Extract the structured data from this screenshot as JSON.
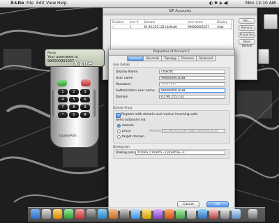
{
  "menubar": {
    "app_name": "X-Lite",
    "menus": [
      "File",
      "Edit",
      "View",
      "Help"
    ],
    "clock": "Mon 12:10 AM"
  },
  "desktop": {
    "icons": [
      {
        "name": "hard-drive-icon",
        "label": ""
      },
      {
        "name": "document-icon",
        "label": "..."
      }
    ]
  },
  "sip_accounts": {
    "title": "SIP Accounts",
    "columns": [
      "Enabled",
      "Acct #",
      "Domain",
      "User name",
      "Display"
    ],
    "rows": [
      {
        "enabled": "✓",
        "acct": "1",
        "domain": "61.90.255.132 (default)",
        "user": "990000001037",
        "display": "chak"
      }
    ],
    "buttons": [
      "Add...",
      "Remove",
      "Properties",
      "Make Default"
    ]
  },
  "phone": {
    "screen_title": "Ready",
    "screen_text": "Your username is: 990000001037",
    "logo": "X-Lite",
    "brand": "CounterPath",
    "keys": [
      "1",
      "2",
      "3",
      "4",
      "5",
      "6",
      "7",
      "8",
      "9",
      "*",
      "0",
      "#"
    ]
  },
  "props": {
    "title": "Properties of Account 1",
    "tabs": [
      "Account",
      "Voicemail",
      "Topology",
      "Presence",
      "Advanced"
    ],
    "user_details": {
      "group_title": "User Details",
      "display_name_label": "Display Name",
      "display_name": "chaktat",
      "user_name_label": "User name",
      "user_name": "990000001038",
      "password_label": "Password",
      "password": "••••••••",
      "auth_label": "Authorization user name",
      "auth_name": "990000001038",
      "domain_label": "Domain",
      "domain": "61.90.255.132"
    },
    "domain_proxy": {
      "group_title": "Domain Proxy",
      "register_label": "Register with domain and receive incoming calls",
      "send_via_label": "Send outbound via:",
      "options": [
        "domain",
        "proxy",
        "target domain"
      ],
      "address_label": "Address",
      "address_value": "61.90.226.194.static.asianet.co.th"
    },
    "dialing_plan": {
      "group_title": "Dialing plan",
      "label": "Dialing plan",
      "value": "#1\\a\\a.T;match=1;prestrip=2;"
    },
    "cancel_label": "Cancel",
    "ok_label": "OK"
  }
}
